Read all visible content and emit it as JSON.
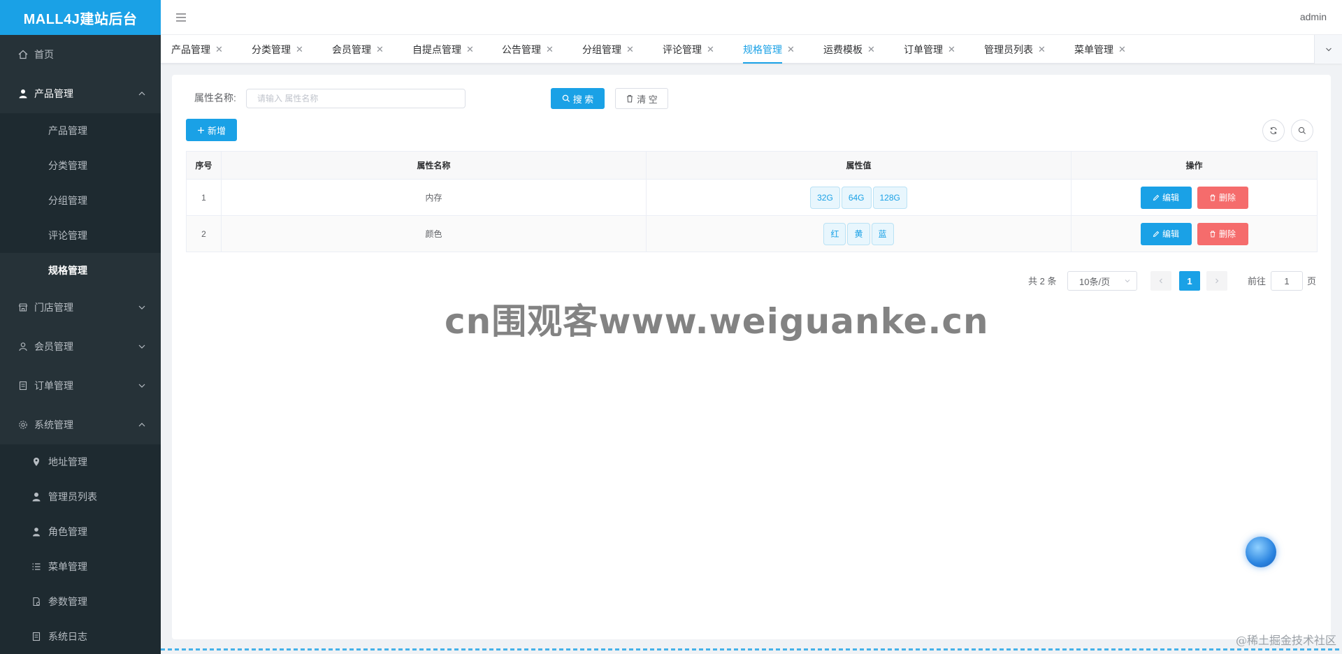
{
  "app": {
    "title": "MALL4J建站后台"
  },
  "header": {
    "user": "admin"
  },
  "sidebar": {
    "home": "首页",
    "product": {
      "label": "产品管理",
      "items": [
        "产品管理",
        "分类管理",
        "分组管理",
        "评论管理",
        "规格管理"
      ]
    },
    "store": "门店管理",
    "member": "会员管理",
    "order": "订单管理",
    "system": {
      "label": "系统管理",
      "items": [
        "地址管理",
        "管理员列表",
        "角色管理",
        "菜单管理",
        "参数管理",
        "系统日志"
      ]
    }
  },
  "tabs": [
    "产品管理",
    "分类管理",
    "会员管理",
    "自提点管理",
    "公告管理",
    "分组管理",
    "评论管理",
    "规格管理",
    "运费模板",
    "订单管理",
    "管理员列表",
    "菜单管理"
  ],
  "active_tab": "规格管理",
  "search": {
    "label": "属性名称:",
    "placeholder": "请输入 属性名称",
    "search_btn": "搜 索",
    "clear_btn": "清 空"
  },
  "toolbar": {
    "add_btn": "新增"
  },
  "table": {
    "headers": [
      "序号",
      "属性名称",
      "属性值",
      "操作"
    ],
    "rows": [
      {
        "index": "1",
        "name": "内存",
        "values": [
          "32G",
          "64G",
          "128G"
        ]
      },
      {
        "index": "2",
        "name": "颜色",
        "values": [
          "红",
          "黄",
          "蓝"
        ]
      }
    ],
    "edit_btn": "编辑",
    "delete_btn": "删除"
  },
  "pagination": {
    "total": "共 2 条",
    "page_size": "10条/页",
    "current": "1",
    "goto_label": "前往",
    "goto_value": "1",
    "page_suffix": "页"
  },
  "watermark": "cn围观客www.weiguanke.cn",
  "corner_watermark": "@稀土掘金技术社区",
  "colors": {
    "primary": "#1aa1e6",
    "danger": "#f56c6c",
    "sidebar_bg": "#263238"
  }
}
